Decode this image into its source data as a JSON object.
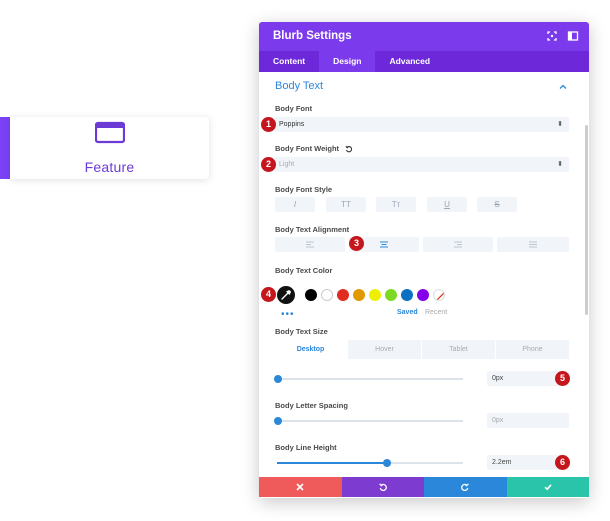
{
  "preview": {
    "label": "Feature"
  },
  "panel": {
    "title": "Blurb Settings",
    "tabs": [
      {
        "label": "Content"
      },
      {
        "label": "Design"
      },
      {
        "label": "Advanced"
      }
    ],
    "section_title": "Body Text",
    "body_font": {
      "label": "Body Font",
      "value": "Poppins"
    },
    "body_font_weight": {
      "label": "Body Font Weight",
      "value": "Light"
    },
    "body_font_style": {
      "label": "Body Font Style",
      "options": [
        "I",
        "TT",
        "Tт",
        "U",
        "S"
      ]
    },
    "body_text_alignment": {
      "label": "Body Text Alignment"
    },
    "body_text_color": {
      "label": "Body Text Color",
      "swatches": [
        "#000000",
        "#ffffff",
        "#e02b20",
        "#e09900",
        "#edf000",
        "#7cda24",
        "#0c71c3",
        "#8300e9"
      ],
      "more": "•••",
      "saved": "Saved",
      "recent": "Recent"
    },
    "body_text_size": {
      "label": "Body Text Size",
      "devices": [
        "Desktop",
        "Hover",
        "Tablet",
        "Phone"
      ],
      "value": "0px"
    },
    "body_letter_spacing": {
      "label": "Body Letter Spacing",
      "value": "0px"
    },
    "body_line_height": {
      "label": "Body Line Height",
      "value": "2.2em"
    }
  },
  "badges": [
    "1",
    "2",
    "3",
    "4",
    "5",
    "6"
  ],
  "footer_colors": {
    "cancel": "#ef5a5a",
    "undo": "#7e3bd0",
    "redo": "#2b87da",
    "save": "#29c4a9"
  },
  "accent": "#7c3aed"
}
